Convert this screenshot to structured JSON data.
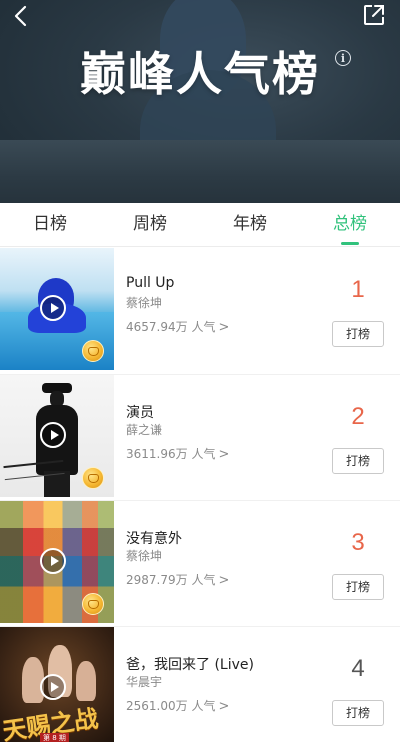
{
  "header": {
    "title": "巅峰人气榜",
    "info_glyph": "i"
  },
  "tabs": [
    {
      "label": "日榜",
      "active": false
    },
    {
      "label": "周榜",
      "active": false
    },
    {
      "label": "年榜",
      "active": false
    },
    {
      "label": "总榜",
      "active": true
    }
  ],
  "accent_color": "#31c27c",
  "rank_colors": {
    "top3": "#e8664a",
    "other": "#555555"
  },
  "songs": [
    {
      "title": "Pull Up",
      "artist": "蔡徐坤",
      "popularity": "4657.94万 人气",
      "rank": "1",
      "vote_label": "打榜"
    },
    {
      "title": "演员",
      "artist": "薛之谦",
      "popularity": "3611.96万 人气",
      "rank": "2",
      "vote_label": "打榜"
    },
    {
      "title": "没有意外",
      "artist": "蔡徐坤",
      "popularity": "2987.79万 人气",
      "rank": "3",
      "vote_label": "打榜"
    },
    {
      "title": "爸，我回来了 (Live)",
      "artist": "华晨宇",
      "popularity": "2561.00万 人气",
      "rank": "4",
      "vote_label": "打榜"
    }
  ],
  "covers": {
    "cover_4_text": "天赐之战",
    "cover_4_sub": "第 8 期"
  }
}
